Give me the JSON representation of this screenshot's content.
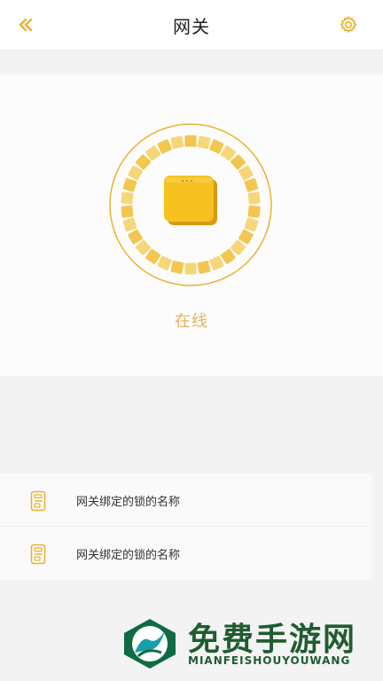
{
  "header": {
    "title": "网关",
    "back_icon": "double-chevron-left-icon",
    "settings_icon": "gear-icon"
  },
  "status": {
    "text": "在线",
    "device_icon": "gateway-device-icon"
  },
  "locks": [
    {
      "name": "网关绑定的锁的名称",
      "icon": "door-lock-icon"
    },
    {
      "name": "网关绑定的锁的名称",
      "icon": "door-lock-icon"
    }
  ],
  "watermark": {
    "title": "免费手游网",
    "subtitle": "MIANFEISHOUYOUWANG"
  },
  "colors": {
    "accent": "#e9b230",
    "status_text": "#e4b45a",
    "background": "#f3f3f3",
    "card": "#fcfcfc"
  }
}
